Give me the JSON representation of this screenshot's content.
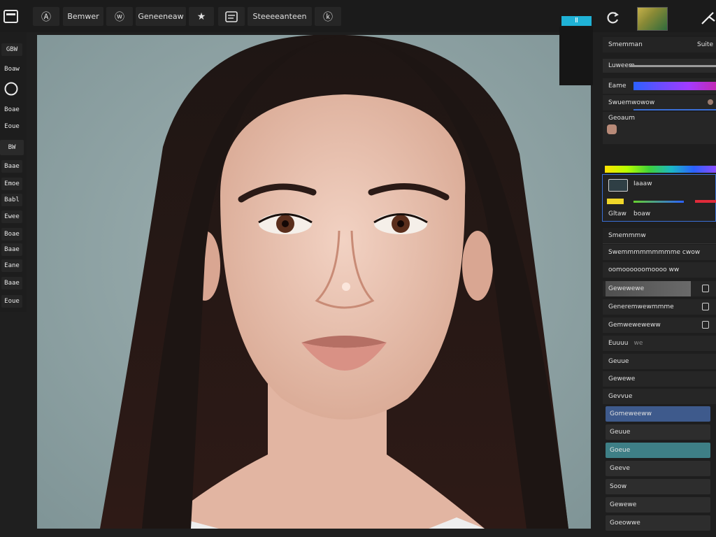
{
  "toolbar": {
    "btn1": "Ⓐ",
    "btn2_label": "Bemwer",
    "btn3": "ⓦ",
    "btn4_label": "Geneeneaw",
    "btn5": "★",
    "btn6_label": "Steeeeanteen",
    "btn7": "ⓚ",
    "badge": "Ⅱ"
  },
  "left_tools": [
    "GBW",
    "Boaw",
    "",
    "Boae",
    "Eoue",
    "BW",
    "Baae",
    "Emoe",
    "Babl",
    "Ewee",
    "Boae",
    "Baae",
    "Eane",
    "Baae",
    "Eoue"
  ],
  "right_panel": {
    "header_left": "Smemman",
    "header_right": "Suite",
    "slider_label": "Luweem",
    "color_label": "Eame",
    "row_gradient": "Swuemwowow",
    "row_swatch": "Geoaum",
    "adjust_label": "Iaaaw",
    "adjust_row2": "Gltaw",
    "adjust_row2_right": "boaw",
    "row_a": "Smemmmw",
    "row_b": "Swemmmmmmmmme cwow",
    "row_c": "oomoooooomoooo ww",
    "row_d": "Gewewewe",
    "row_e": "Generemwewmmme",
    "row_f": "Gemweweweww",
    "row_g": "Euuuu",
    "row_g_right": "we",
    "row_h": "Geuue",
    "row_i": "Gewewe",
    "row_j": "Gevvue",
    "list": [
      "Gomeweeww",
      "Geuue",
      "Goeue",
      "Geeve",
      "Soow",
      "Gewewe",
      "Goeowwe"
    ]
  },
  "colors": {
    "accent_cyan": "#1fb2d6",
    "accent_blue": "#3e5a8c",
    "accent_teal": "#3e7f86",
    "bg": "#1f1f1f"
  }
}
